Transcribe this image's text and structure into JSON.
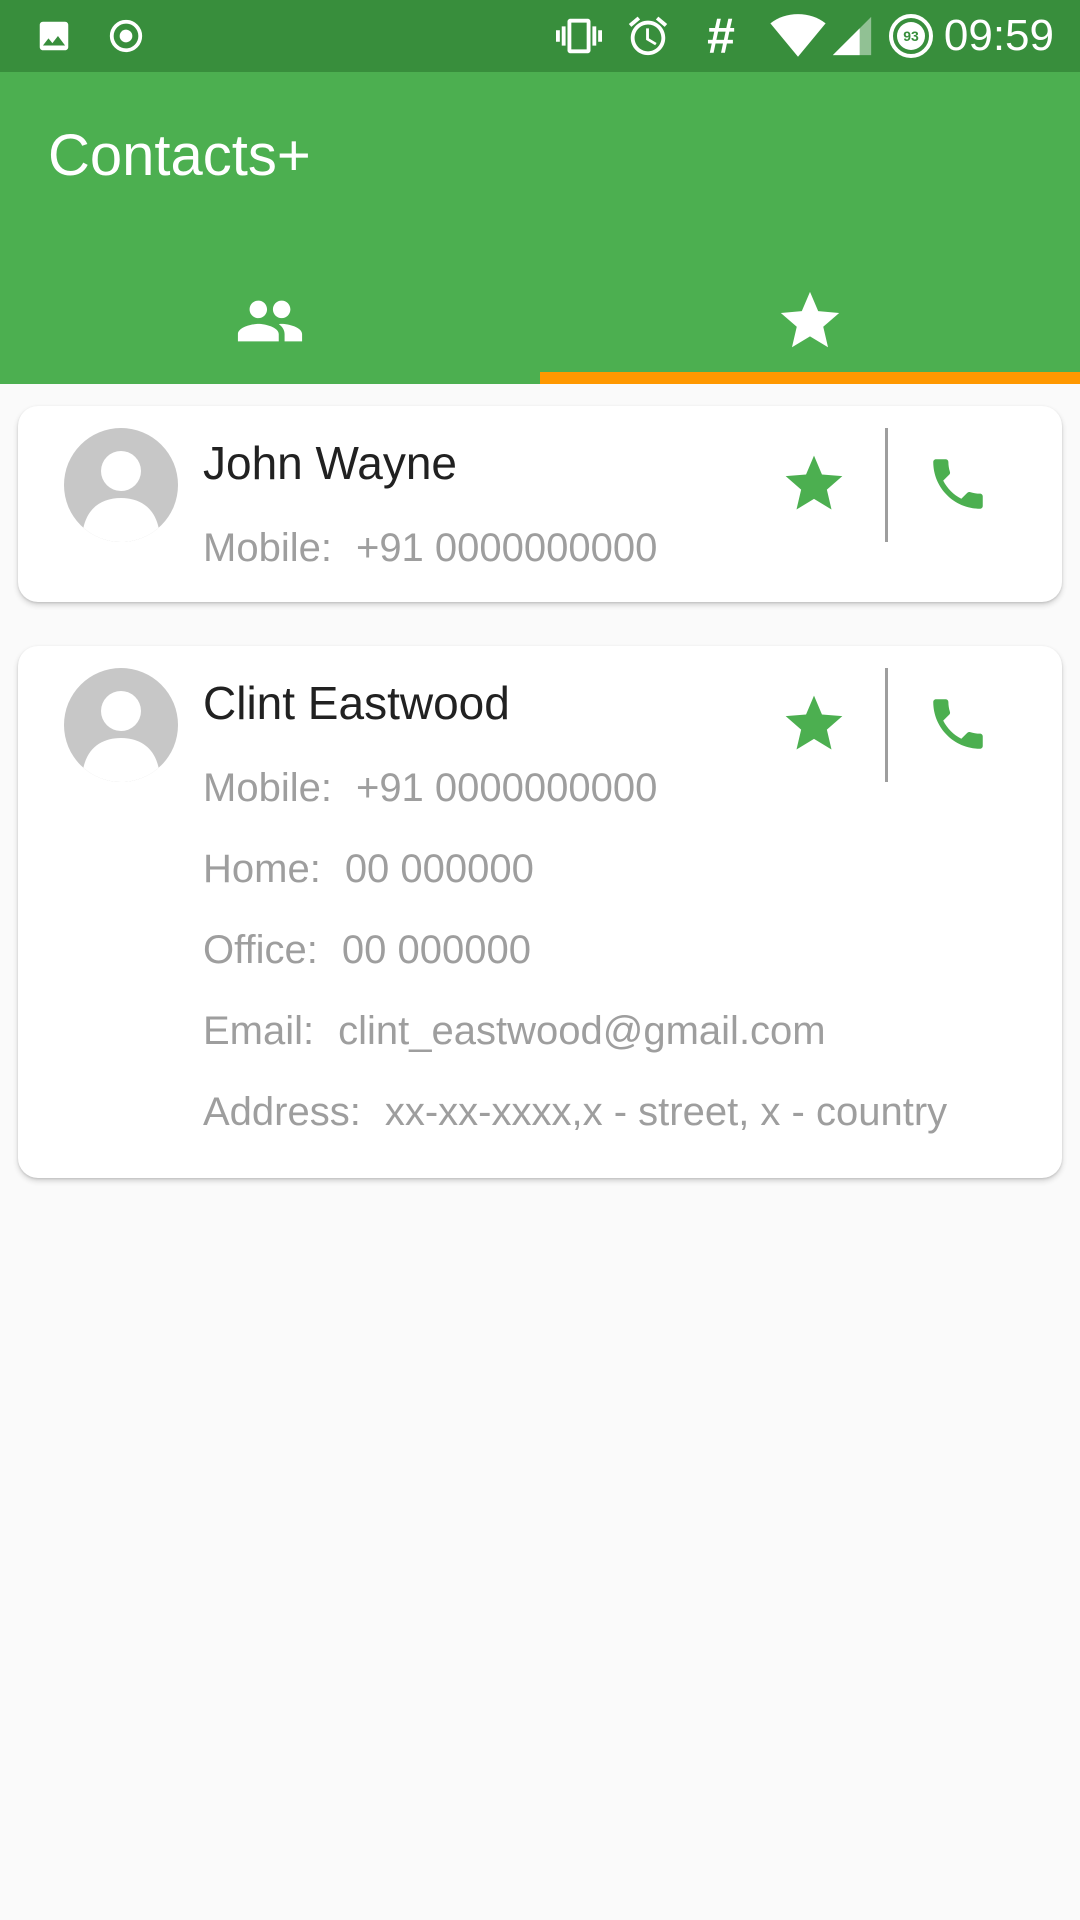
{
  "status_bar": {
    "time": "09:59",
    "battery_level": "93",
    "sync_symbol": "#",
    "icons": [
      "image-icon",
      "record-icon",
      "vibrate-icon",
      "alarm-icon",
      "hash-icon",
      "wifi-icon",
      "signal-icon",
      "battery-icon"
    ]
  },
  "app_bar": {
    "title": "Contacts+",
    "tabs": [
      {
        "icon": "people-icon",
        "active": false
      },
      {
        "icon": "star-icon",
        "active": true
      }
    ]
  },
  "colors": {
    "primary": "#4caf50",
    "primary_dark": "#388e3c",
    "accent": "#ff9800",
    "secondary_text": "#9e9e9e"
  },
  "contacts": [
    {
      "name": "John Wayne",
      "favorite": true,
      "fields": [
        {
          "label": "Mobile:",
          "value": "+91 0000000000"
        }
      ]
    },
    {
      "name": "Clint Eastwood",
      "favorite": true,
      "fields": [
        {
          "label": "Mobile:",
          "value": "+91 0000000000"
        },
        {
          "label": "Home:",
          "value": "00 000000"
        },
        {
          "label": "Office:",
          "value": "00 000000"
        },
        {
          "label": "Email:",
          "value": "clint_eastwood@gmail.com"
        },
        {
          "label": "Address:",
          "value": "xx-xx-xxxx,x - street, x - country"
        }
      ]
    }
  ]
}
